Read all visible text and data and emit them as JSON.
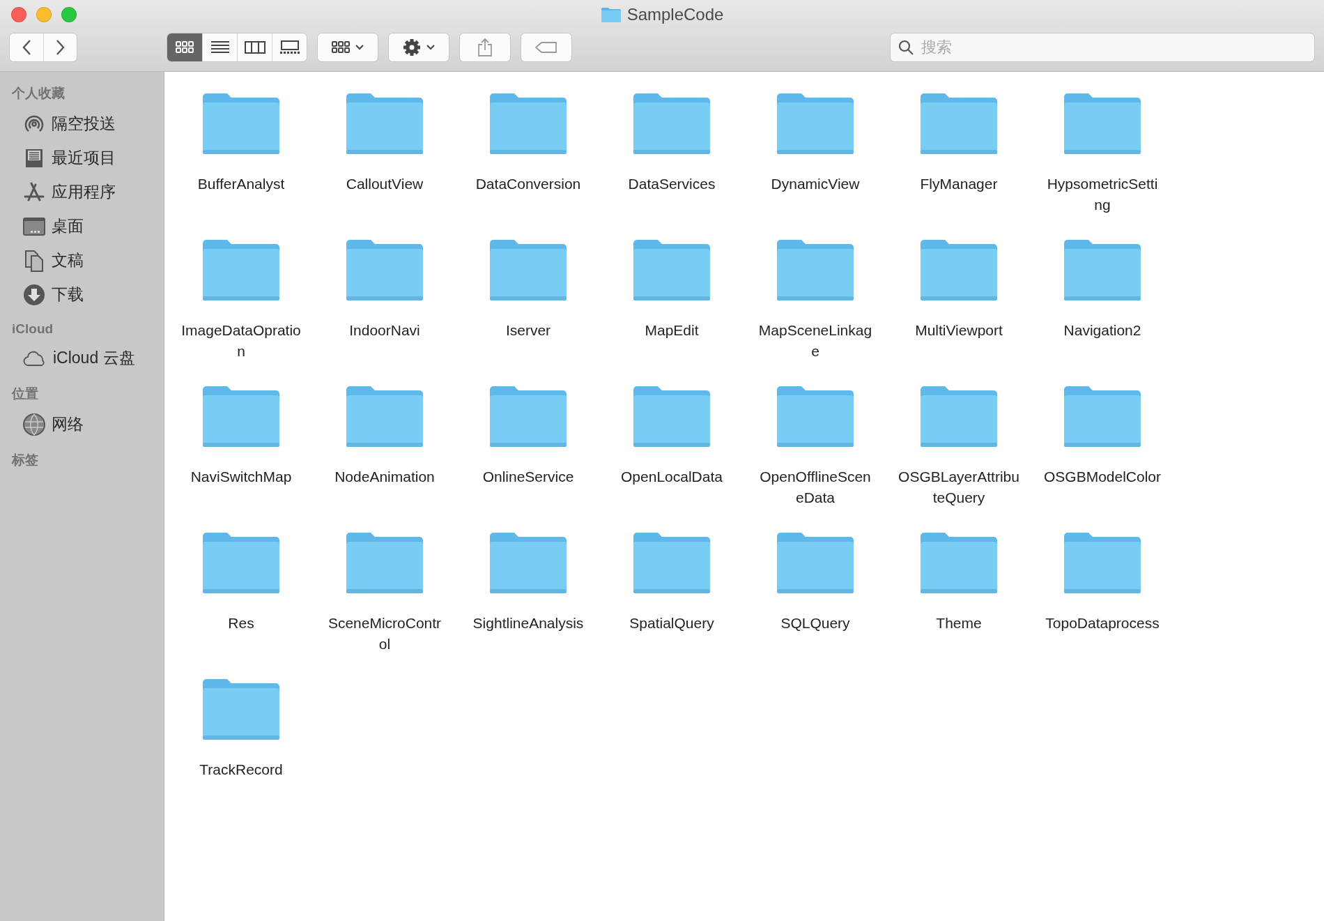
{
  "window": {
    "title": "SampleCode"
  },
  "toolbar": {
    "view_modes": [
      {
        "kind": "icons",
        "selected": true
      },
      {
        "kind": "list",
        "selected": false
      },
      {
        "kind": "columns",
        "selected": false
      },
      {
        "kind": "gallery",
        "selected": false
      }
    ],
    "search": {
      "placeholder": "搜索"
    }
  },
  "sidebar": {
    "sections": [
      {
        "title": "个人收藏",
        "items": [
          {
            "kind": "airdrop",
            "label": "隔空投送"
          },
          {
            "kind": "recents",
            "label": "最近项目"
          },
          {
            "kind": "apps",
            "label": "应用程序"
          },
          {
            "kind": "desktop",
            "label": "桌面"
          },
          {
            "kind": "documents",
            "label": "文稿"
          },
          {
            "kind": "downloads",
            "label": "下载"
          }
        ]
      },
      {
        "title": "iCloud",
        "items": [
          {
            "kind": "cloud",
            "label": "iCloud 云盘"
          }
        ]
      },
      {
        "title": "位置",
        "items": [
          {
            "kind": "network",
            "label": "网络"
          }
        ]
      },
      {
        "title": "标签"
      }
    ]
  },
  "folders": [
    {
      "name_lines": [
        "BufferAnalyst"
      ]
    },
    {
      "name_lines": [
        "CalloutView"
      ]
    },
    {
      "name_lines": [
        "DataConversion"
      ]
    },
    {
      "name_lines": [
        "DataServices"
      ]
    },
    {
      "name_lines": [
        "DynamicView"
      ]
    },
    {
      "name_lines": [
        "FlyManager"
      ]
    },
    {
      "name_lines": [
        "HypsometricSetti",
        "ng"
      ]
    },
    {
      "name_lines": [
        "ImageDataOpratio",
        "n"
      ]
    },
    {
      "name_lines": [
        "IndoorNavi"
      ]
    },
    {
      "name_lines": [
        "Iserver"
      ]
    },
    {
      "name_lines": [
        "MapEdit"
      ]
    },
    {
      "name_lines": [
        "MapSceneLinkag",
        "e"
      ]
    },
    {
      "name_lines": [
        "MultiViewport"
      ]
    },
    {
      "name_lines": [
        "Navigation2"
      ]
    },
    {
      "name_lines": [
        "NaviSwitchMap"
      ]
    },
    {
      "name_lines": [
        "NodeAnimation"
      ]
    },
    {
      "name_lines": [
        "OnlineService"
      ]
    },
    {
      "name_lines": [
        "OpenLocalData"
      ]
    },
    {
      "name_lines": [
        "OpenOfflineScen",
        "eData"
      ]
    },
    {
      "name_lines": [
        "OSGBLayerAttribu",
        "teQuery"
      ]
    },
    {
      "name_lines": [
        "OSGBModelColor"
      ]
    },
    {
      "name_lines": [
        "Res"
      ]
    },
    {
      "name_lines": [
        "SceneMicroContr",
        "ol"
      ]
    },
    {
      "name_lines": [
        "SightlineAnalysis"
      ]
    },
    {
      "name_lines": [
        "SpatialQuery"
      ]
    },
    {
      "name_lines": [
        "SQLQuery"
      ]
    },
    {
      "name_lines": [
        "Theme"
      ]
    },
    {
      "name_lines": [
        "TopoDataprocess"
      ]
    },
    {
      "name_lines": [
        "TrackRecord"
      ]
    }
  ]
}
